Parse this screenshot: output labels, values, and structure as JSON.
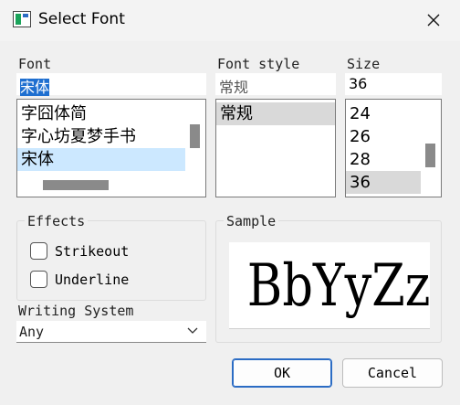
{
  "window": {
    "title": "Select Font"
  },
  "font": {
    "label": "Font",
    "value": "宋体",
    "items": [
      "字囧体简",
      "字心坊夏梦手书",
      "宋体"
    ]
  },
  "style": {
    "label": "Font style",
    "value": "常规",
    "items": [
      "常规"
    ]
  },
  "size": {
    "label": "Size",
    "value": "36",
    "items": [
      "24",
      "26",
      "28",
      "36"
    ]
  },
  "effects": {
    "title": "Effects",
    "strikeout": "Strikeout",
    "underline": "Underline"
  },
  "writing_system": {
    "label": "Writing System",
    "value": "Any"
  },
  "sample": {
    "title": "Sample",
    "text": "BbYyZz"
  },
  "buttons": {
    "ok": "OK",
    "cancel": "Cancel"
  },
  "colors": {
    "selection": "#cce8ff",
    "accent": "#2b6cc4"
  }
}
